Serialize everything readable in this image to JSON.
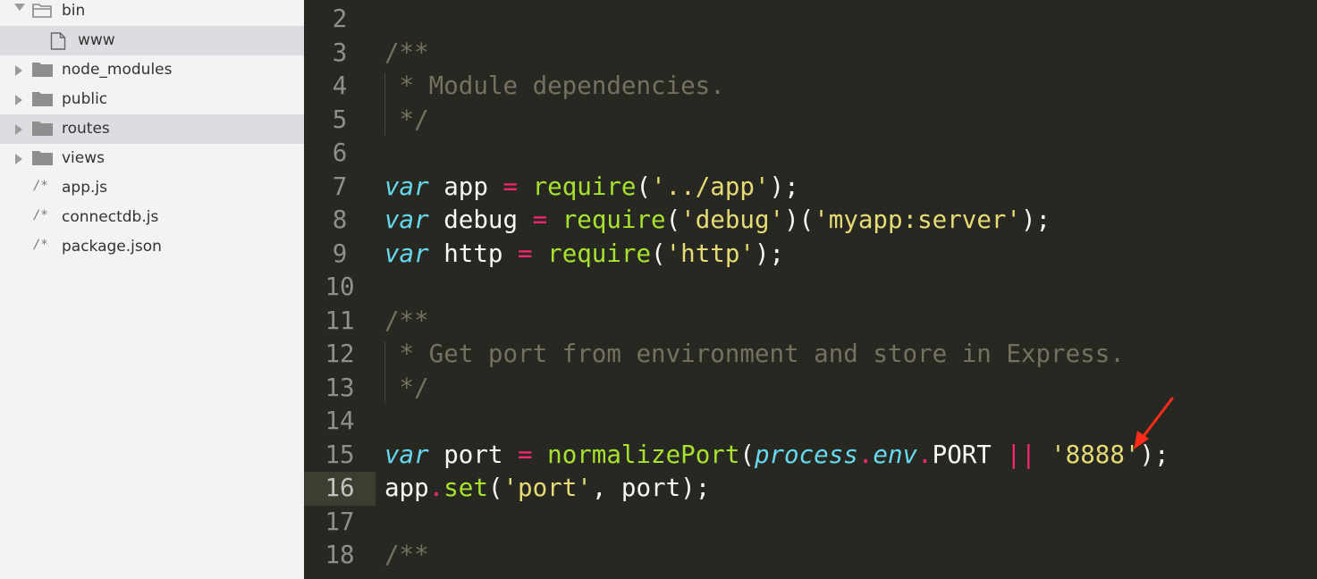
{
  "sidebar": {
    "items": [
      {
        "label": "bin",
        "kind": "folder",
        "state": "open",
        "depth": 0
      },
      {
        "label": "www",
        "kind": "file",
        "depth": 1,
        "selected": true
      },
      {
        "label": "node_modules",
        "kind": "folder",
        "state": "closed",
        "depth": 0
      },
      {
        "label": "public",
        "kind": "folder",
        "state": "closed",
        "depth": 0
      },
      {
        "label": "routes",
        "kind": "folder",
        "state": "closed",
        "depth": 0,
        "highlighted": true
      },
      {
        "label": "views",
        "kind": "folder",
        "state": "closed",
        "depth": 0
      },
      {
        "label": "app.js",
        "kind": "js",
        "depth": 0
      },
      {
        "label": "connectdb.js",
        "kind": "js",
        "depth": 0
      },
      {
        "label": "package.json",
        "kind": "js",
        "depth": 0
      }
    ],
    "js_icon_glyph": "/*"
  },
  "editor": {
    "active_line": "16",
    "lines": [
      {
        "num": "2",
        "tokens": []
      },
      {
        "num": "3",
        "tokens": [
          {
            "t": "/**",
            "c": "comment"
          }
        ]
      },
      {
        "num": "4",
        "tokens": [
          {
            "t": " * Module dependencies.",
            "c": "comment"
          }
        ]
      },
      {
        "num": "5",
        "tokens": [
          {
            "t": " */",
            "c": "comment"
          }
        ]
      },
      {
        "num": "6",
        "tokens": []
      },
      {
        "num": "7",
        "tokens": [
          {
            "t": "var",
            "c": "keyword"
          },
          {
            "t": " app ",
            "c": "plain"
          },
          {
            "t": "=",
            "c": "operator"
          },
          {
            "t": " ",
            "c": "plain"
          },
          {
            "t": "require",
            "c": "func"
          },
          {
            "t": "(",
            "c": "plain"
          },
          {
            "t": "'../app'",
            "c": "string"
          },
          {
            "t": ");",
            "c": "plain"
          }
        ]
      },
      {
        "num": "8",
        "tokens": [
          {
            "t": "var",
            "c": "keyword"
          },
          {
            "t": " debug ",
            "c": "plain"
          },
          {
            "t": "=",
            "c": "operator"
          },
          {
            "t": " ",
            "c": "plain"
          },
          {
            "t": "require",
            "c": "func"
          },
          {
            "t": "(",
            "c": "plain"
          },
          {
            "t": "'debug'",
            "c": "string"
          },
          {
            "t": ")(",
            "c": "plain"
          },
          {
            "t": "'myapp:server'",
            "c": "string"
          },
          {
            "t": ");",
            "c": "plain"
          }
        ]
      },
      {
        "num": "9",
        "tokens": [
          {
            "t": "var",
            "c": "keyword"
          },
          {
            "t": " http ",
            "c": "plain"
          },
          {
            "t": "=",
            "c": "operator"
          },
          {
            "t": " ",
            "c": "plain"
          },
          {
            "t": "require",
            "c": "func"
          },
          {
            "t": "(",
            "c": "plain"
          },
          {
            "t": "'http'",
            "c": "string"
          },
          {
            "t": ");",
            "c": "plain"
          }
        ]
      },
      {
        "num": "10",
        "tokens": []
      },
      {
        "num": "11",
        "tokens": [
          {
            "t": "/**",
            "c": "comment"
          }
        ]
      },
      {
        "num": "12",
        "tokens": [
          {
            "t": " * Get port from environment and store in Express.",
            "c": "comment"
          }
        ]
      },
      {
        "num": "13",
        "tokens": [
          {
            "t": " */",
            "c": "comment"
          }
        ]
      },
      {
        "num": "14",
        "tokens": []
      },
      {
        "num": "15",
        "tokens": [
          {
            "t": "var",
            "c": "keyword"
          },
          {
            "t": " port ",
            "c": "plain"
          },
          {
            "t": "=",
            "c": "operator"
          },
          {
            "t": " ",
            "c": "plain"
          },
          {
            "t": "normalizePort",
            "c": "func"
          },
          {
            "t": "(",
            "c": "plain"
          },
          {
            "t": "process",
            "c": "global"
          },
          {
            "t": ".",
            "c": "operator"
          },
          {
            "t": "env",
            "c": "global"
          },
          {
            "t": ".",
            "c": "operator"
          },
          {
            "t": "PORT ",
            "c": "plain"
          },
          {
            "t": "||",
            "c": "operator"
          },
          {
            "t": " ",
            "c": "plain"
          },
          {
            "t": "'8888'",
            "c": "string"
          },
          {
            "t": ");",
            "c": "plain"
          }
        ]
      },
      {
        "num": "16",
        "tokens": [
          {
            "t": "app",
            "c": "plain"
          },
          {
            "t": ".",
            "c": "operator"
          },
          {
            "t": "set",
            "c": "func"
          },
          {
            "t": "(",
            "c": "plain"
          },
          {
            "t": "'port'",
            "c": "string"
          },
          {
            "t": ", port);",
            "c": "plain"
          }
        ]
      },
      {
        "num": "17",
        "tokens": []
      },
      {
        "num": "18",
        "tokens": [
          {
            "t": "/**",
            "c": "comment"
          }
        ]
      }
    ]
  },
  "colors": {
    "editor_bg": "#272822",
    "sidebar_bg": "#f3f3f3",
    "keyword": "#66d9ef",
    "string": "#e6db74",
    "function": "#a6e22e",
    "operator": "#f92672",
    "comment": "#75715e",
    "annotation_arrow": "#ff2a1a"
  }
}
